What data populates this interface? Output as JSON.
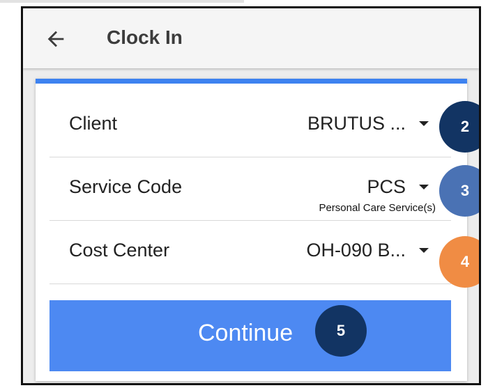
{
  "app_bar": {
    "back_icon": "arrow-left-icon",
    "title": "Clock In"
  },
  "form": {
    "accent_color": "#3d82f0",
    "rows": [
      {
        "label": "Client",
        "value": "BRUTUS ...",
        "subtext": ""
      },
      {
        "label": "Service Code",
        "value": "PCS",
        "subtext": "Personal Care Service(s)"
      },
      {
        "label": "Cost Center",
        "value": "OH-090 B...",
        "subtext": ""
      }
    ],
    "continue_label": "Continue",
    "continue_color": "#4d89f2"
  },
  "callouts": [
    {
      "number": "2",
      "color": "#123463"
    },
    {
      "number": "3",
      "color": "#4a72b4"
    },
    {
      "number": "4",
      "color": "#f08c44"
    },
    {
      "number": "5",
      "color": "#123463"
    }
  ]
}
